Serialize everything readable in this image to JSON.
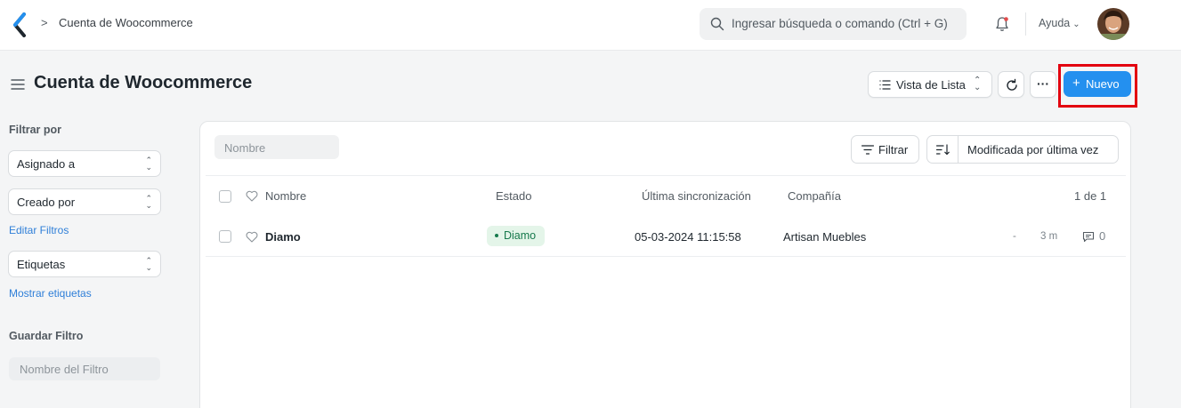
{
  "navbar": {
    "breadcrumb_sep": ">",
    "breadcrumb": "Cuenta de Woocommerce",
    "search_placeholder": "Ingresar búsqueda o comando (Ctrl + G)",
    "help_label": "Ayuda"
  },
  "page": {
    "title": "Cuenta de Woocommerce",
    "view_label": "Vista de Lista",
    "more_label": "···",
    "new_label": "Nuevo",
    "new_plus": "+"
  },
  "sidebar": {
    "filter_heading": "Filtrar por",
    "filters": [
      "Asignado a",
      "Creado por"
    ],
    "edit_filters": "Editar Filtros",
    "tags_label": "Etiquetas",
    "show_tags": "Mostrar etiquetas",
    "save_heading": "Guardar Filtro",
    "filter_name_placeholder": "Nombre del Filtro"
  },
  "list": {
    "name_placeholder": "Nombre",
    "filter_label": "Filtrar",
    "sort_label": "Modificada por última vez",
    "columns": {
      "name": "Nombre",
      "status": "Estado",
      "last_sync": "Última sincronización",
      "company": "Compañía",
      "count": "1 de 1"
    },
    "rows": [
      {
        "name": "Diamo",
        "status": "Diamo",
        "last_sync": "05-03-2024 11:15:58",
        "company": "Artisan Muebles",
        "dash": "-",
        "modified": "3 m",
        "comments": "0"
      }
    ]
  },
  "colors": {
    "primary": "#2490ef",
    "highlight": "#e3000f",
    "status_bg": "#e4f5e9",
    "status_fg": "#16794c"
  }
}
